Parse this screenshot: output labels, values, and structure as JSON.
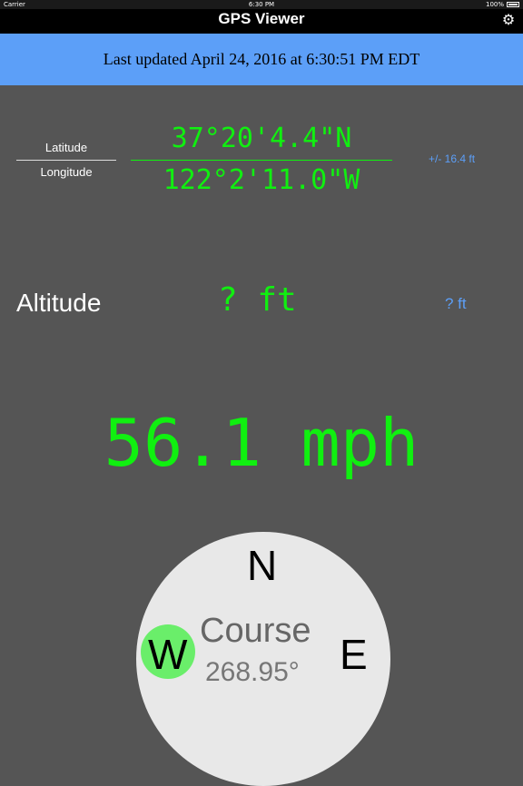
{
  "status_bar": {
    "carrier": "Carrier",
    "time": "6:30 PM",
    "battery": "100%"
  },
  "nav": {
    "title": "GPS Viewer",
    "settings_icon": "gear-icon"
  },
  "banner": {
    "last_updated": "Last updated April 24, 2016 at 6:30:51 PM EDT"
  },
  "location": {
    "latitude_label": "Latitude",
    "longitude_label": "Longitude",
    "latitude": "37°20'4.4\"N",
    "longitude": "122°2'11.0\"W",
    "accuracy": "+/- 16.4 ft"
  },
  "altitude": {
    "label": "Altitude",
    "value": "? ft",
    "accuracy": "? ft"
  },
  "speed": {
    "value": "56.1 mph"
  },
  "compass": {
    "north": "N",
    "east": "E",
    "west": "W",
    "course_label": "Course",
    "course_value": "268.95°"
  },
  "colors": {
    "green": "#10f010",
    "blue": "#5c9ff8",
    "background": "#555555"
  }
}
